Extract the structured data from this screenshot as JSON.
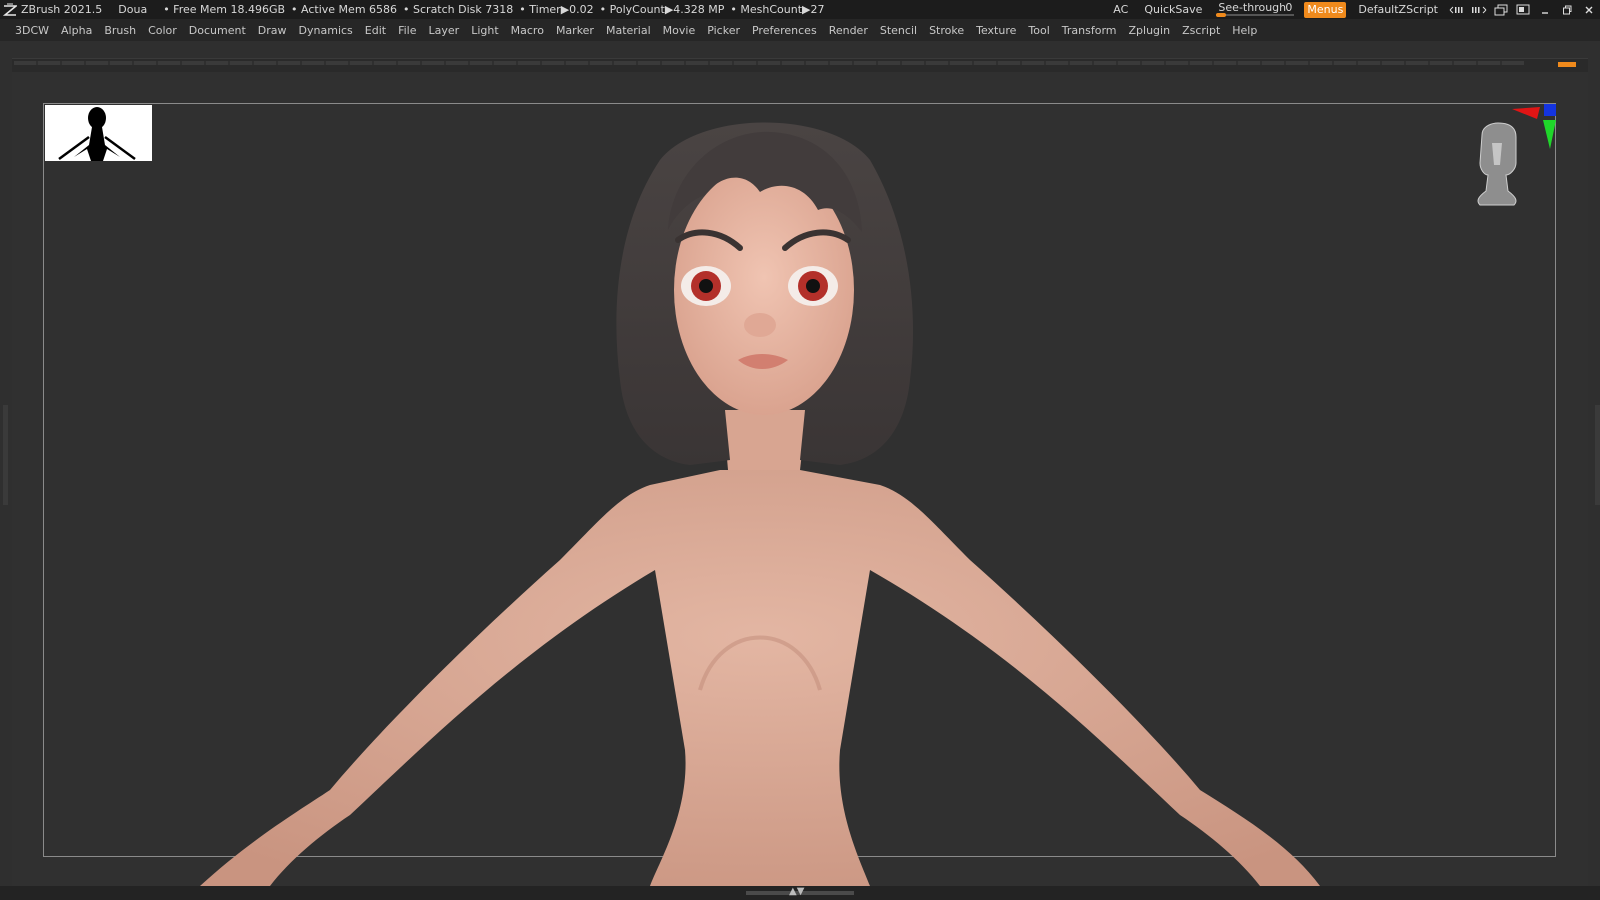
{
  "titlebar": {
    "app": "ZBrush 2021.5",
    "doc": "Doua",
    "stats": [
      "• Free Mem 18.496GB",
      "• Active Mem 6586",
      "• Scratch Disk 7318",
      "• Timer▶0.02",
      "• PolyCount▶4.328 MP",
      "• MeshCount▶27"
    ],
    "ac": "AC",
    "quicksave": "QuickSave",
    "see_through_label": "See-through",
    "see_through_value": "0",
    "see_through_level": 0,
    "menus": "Menus",
    "script": "DefaultZScript",
    "accent": "#f08a1c"
  },
  "menubar": {
    "items": [
      "3DCW",
      "Alpha",
      "Brush",
      "Color",
      "Document",
      "Draw",
      "Dynamics",
      "Edit",
      "File",
      "Layer",
      "Light",
      "Macro",
      "Marker",
      "Material",
      "Movie",
      "Picker",
      "Preferences",
      "Render",
      "Stencil",
      "Stroke",
      "Texture",
      "Tool",
      "Transform",
      "Zplugin",
      "Zscript",
      "Help"
    ]
  },
  "colors": {
    "background": "#303030",
    "skin": "#d9a893",
    "hair": "#3f3a3a",
    "iris": "#b3302a"
  }
}
